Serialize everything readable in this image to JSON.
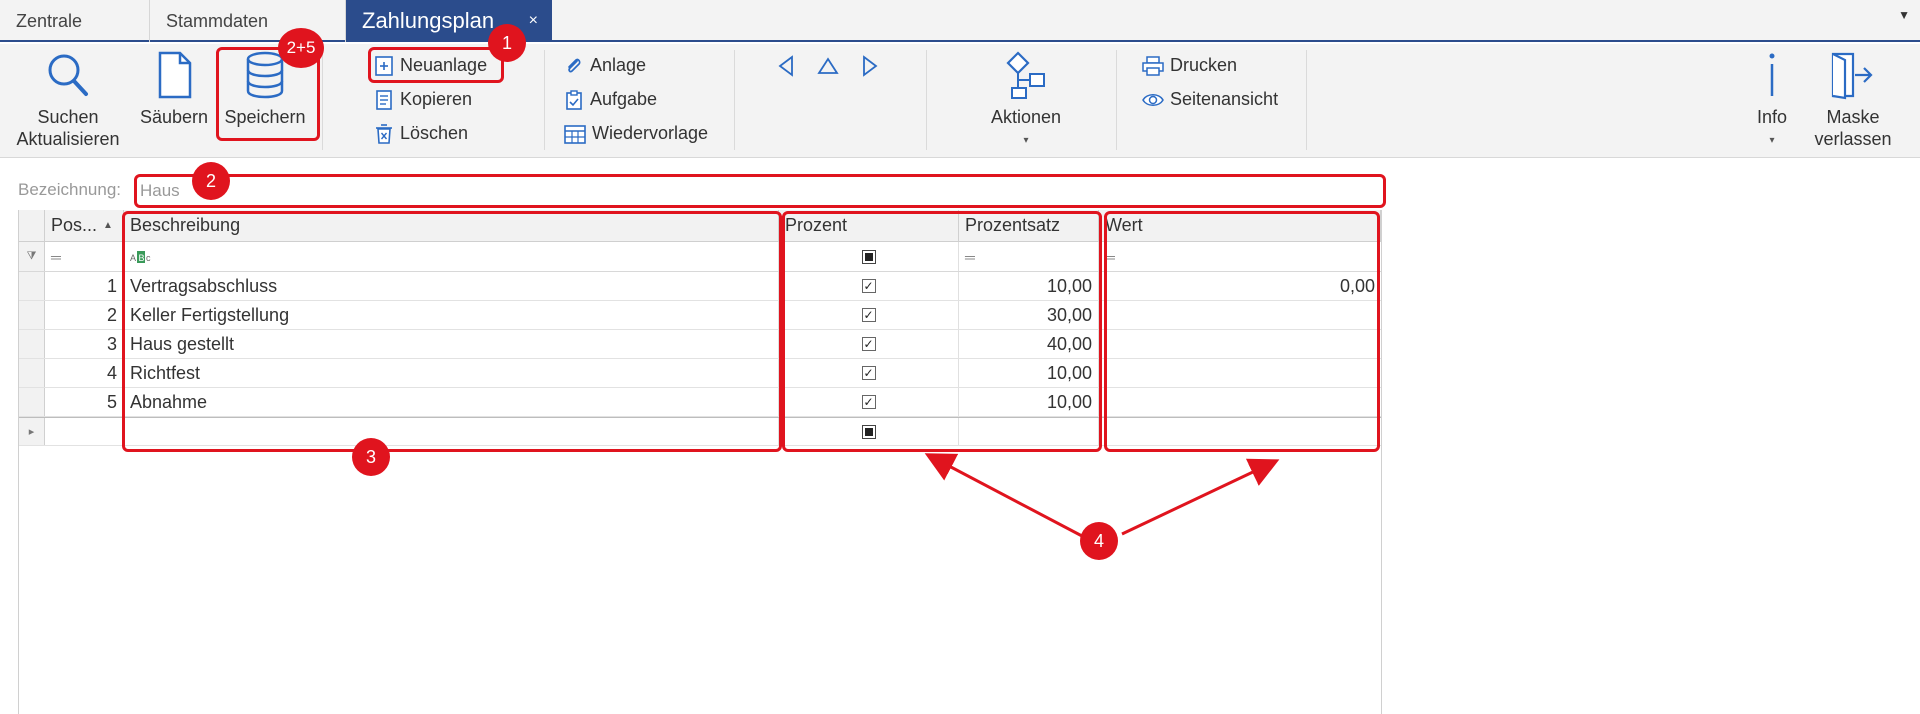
{
  "tabs": [
    {
      "label": "Zentrale"
    },
    {
      "label": "Stammdaten"
    },
    {
      "label": "Zahlungsplan",
      "close": "×"
    }
  ],
  "ribbon": {
    "search": {
      "line1": "Suchen",
      "line2": "Aktualisieren"
    },
    "clear": "Säubern",
    "save": "Speichern",
    "new": "Neuanlage",
    "copy": "Kopieren",
    "delete": "Löschen",
    "attachment": "Anlage",
    "task": "Aufgabe",
    "followup": "Wiedervorlage",
    "actions": "Aktionen",
    "print": "Drucken",
    "preview": "Seitenansicht",
    "info": "Info",
    "exit": {
      "line1": "Maske",
      "line2": "verlassen"
    }
  },
  "form": {
    "label": "Bezeichnung:",
    "value": "Haus"
  },
  "grid": {
    "columns": [
      "Pos...",
      "Beschreibung",
      "Prozent",
      "Prozentsatz",
      "Wert"
    ],
    "rows": [
      {
        "pos": "1",
        "desc": "Vertragsabschluss",
        "percent": true,
        "rate": "10,00",
        "value": "0,00"
      },
      {
        "pos": "2",
        "desc": "Keller Fertigstellung",
        "percent": true,
        "rate": "30,00",
        "value": ""
      },
      {
        "pos": "3",
        "desc": "Haus gestellt",
        "percent": true,
        "rate": "40,00",
        "value": ""
      },
      {
        "pos": "4",
        "desc": "Richtfest",
        "percent": true,
        "rate": "10,00",
        "value": ""
      },
      {
        "pos": "5",
        "desc": "Abnahme",
        "percent": true,
        "rate": "10,00",
        "value": ""
      }
    ]
  },
  "annotations": {
    "b1": "1",
    "b2a": "2+5",
    "b2b": "2",
    "b3": "3",
    "b4": "4",
    "color": "#e0141e"
  },
  "colors": {
    "accent": "#2b4c8c",
    "icon": "#2b6bc4"
  }
}
